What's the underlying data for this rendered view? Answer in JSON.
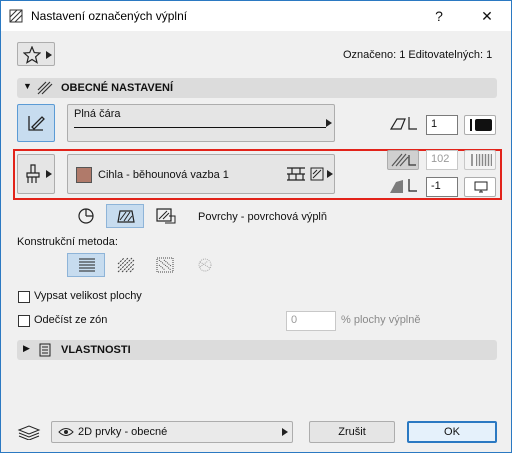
{
  "window": {
    "title": "Nastavení označených výplní",
    "help": "?",
    "close": "✕"
  },
  "top": {
    "favorites_icon": "star-icon",
    "selection_info": "Označeno: 1 Editovatelných: 1"
  },
  "general_section": {
    "title": "OBECNÉ NASTAVENÍ",
    "line_type": "Plná čára",
    "pen_value": "1",
    "fill_name": "Cihla - běhounová vazba 1",
    "fill_pen_value": "102",
    "background_pen_value": "-1",
    "surface_label": "Povrchy - povrchová výplň",
    "construction_method_label": "Konstrukční metoda:",
    "show_area_label": "Vypsat velikost plochy",
    "subtract_zones_label": "Odečíst ze zón",
    "percent_value": "0",
    "percent_label": "% plochy výplně"
  },
  "properties_section": {
    "title": "VLASTNOSTI"
  },
  "footer": {
    "layer_value": "2D prvky - obecné",
    "cancel_label": "Zrušit",
    "ok_label": "OK"
  },
  "colors": {
    "accent": "#2b79c2",
    "highlight": "#c7dcef",
    "frame": "#e2231a",
    "fill_swatch": "#b07a6a"
  }
}
